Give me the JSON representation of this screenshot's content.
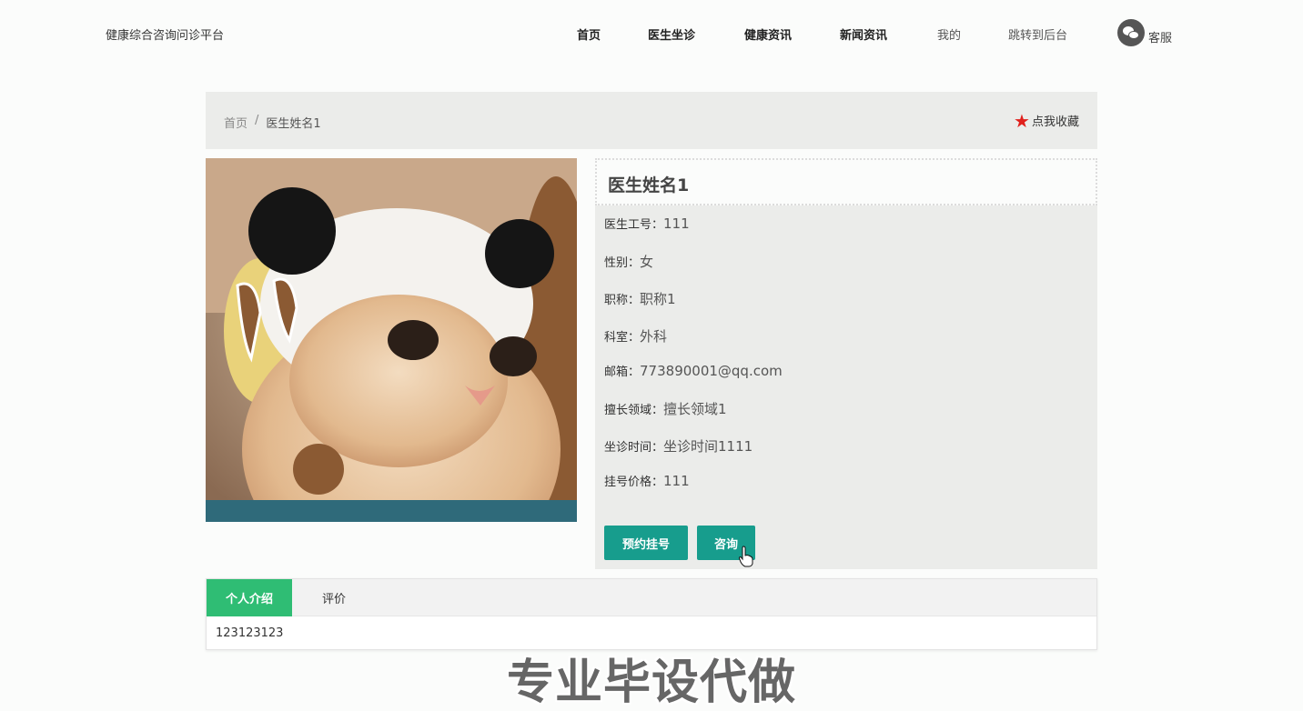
{
  "header": {
    "brand": "健康综合咨询问诊平台",
    "nav": [
      "首页",
      "医生坐诊",
      "健康资讯",
      "新闻资讯",
      "我的",
      "跳转到后台"
    ],
    "service_label": "客服"
  },
  "breadcrumb": {
    "home": "首页",
    "separator": "/",
    "current": "医生姓名1",
    "favorite_label": "点我收藏"
  },
  "doctor": {
    "name": "医生姓名1",
    "fields": [
      {
        "label": "医生工号：",
        "value": "111"
      },
      {
        "label": "性别：",
        "value": "女"
      },
      {
        "label": "职称：",
        "value": "职称1"
      },
      {
        "label": "科室：",
        "value": "外科"
      },
      {
        "label": "邮箱：",
        "value": "773890001@qq.com"
      },
      {
        "label": "擅长领域：",
        "value": "擅长领域1"
      },
      {
        "label": "坐诊时间：",
        "value": "坐诊时间1111"
      },
      {
        "label": "挂号价格：",
        "value": "111"
      }
    ],
    "actions": {
      "book": "预约挂号",
      "consult": "咨询"
    }
  },
  "tabs": {
    "items": [
      "个人介绍",
      "评价"
    ],
    "active": "个人介绍",
    "content": "123123123"
  },
  "watermark": "专业毕设代做",
  "colors": {
    "accent_teal": "#179d8d",
    "tab_active_green": "#2fbd74",
    "star_red": "#e0201c"
  }
}
